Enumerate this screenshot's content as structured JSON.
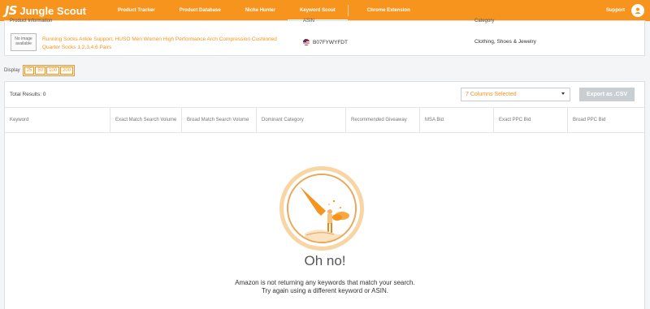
{
  "app": {
    "logo_mark": "JS",
    "logo_text": "Jungle Scout"
  },
  "nav": {
    "items": [
      {
        "label": "Product Tracker"
      },
      {
        "label": "Product Database"
      },
      {
        "label": "Niche Hunter"
      },
      {
        "label": "Keyword Scout"
      },
      {
        "label": "Chrome Extension"
      }
    ],
    "active": "Keyword Scout",
    "support_label": "Support",
    "avatar_icon": "user-icon"
  },
  "product": {
    "header_product": "Product Information",
    "header_asin": "ASIN",
    "header_category": "Category",
    "no_image_text": "No image available",
    "title": "Running Socks Ankle Support, HUSO Men Women High Performance Arch Compression Cushioned Quarter Socks 1,2,3,4,6 Pairs",
    "asin": "B07FYWYFDT",
    "category": "Clothing, Shoes & Jewelry"
  },
  "display": {
    "label": "Display",
    "options": [
      "25",
      "50",
      "100",
      "200"
    ]
  },
  "results": {
    "total_label": "Total Results: 0",
    "columns_selected": "7 Columns Selected",
    "export_label": "Export as .CSV",
    "columns": [
      "Keyword",
      "Exact Match Search Volume",
      "Broad Match Search Volume",
      "Dominant Category",
      "Recommended Giveaway",
      "MSA Bid",
      "Exact PPC Bid",
      "Broad PPC Bid"
    ]
  },
  "empty_state": {
    "title": "Oh no!",
    "line1": "Amazon is not returning any keywords that match your search.",
    "line2": "Try again using a different keyword or ASIN."
  },
  "colors": {
    "brand": "#f7941d",
    "export_disabled": "#c9ced3"
  }
}
